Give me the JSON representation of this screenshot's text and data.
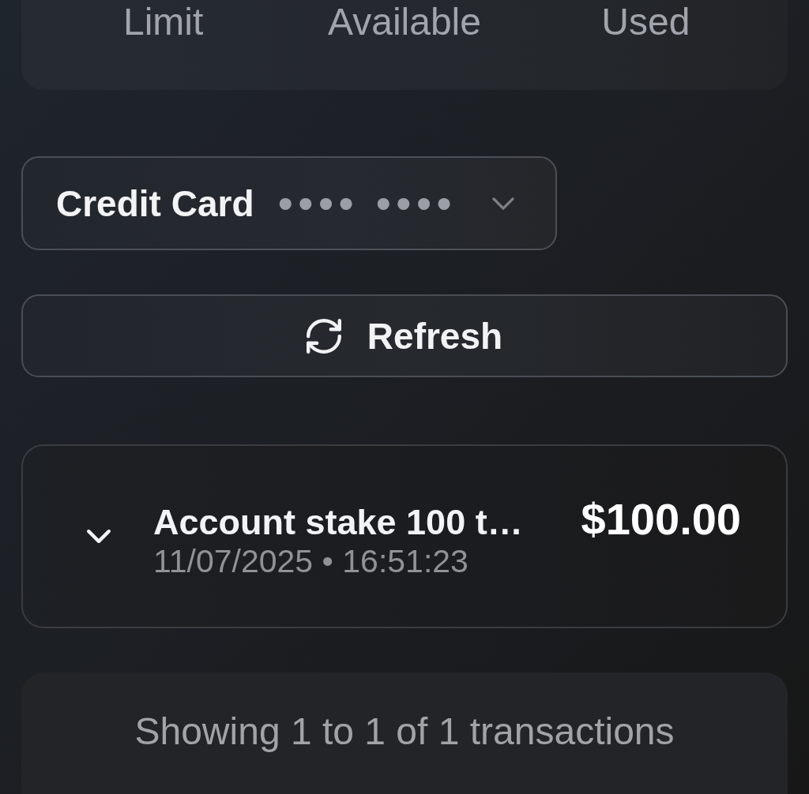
{
  "summary_labels": [
    "Limit",
    "Available",
    "Used"
  ],
  "card_selector": {
    "label": "Credit Card",
    "masked_number": "•••• ••••"
  },
  "refresh_button": {
    "label": "Refresh"
  },
  "transactions": [
    {
      "title": "Account stake 100 t…",
      "datetime": "11/07/2025 • 16:51:23",
      "amount": "$100.00",
      "expanded": false
    }
  ],
  "pagination": {
    "summary": "Showing 1 to 1 of 1 transactions"
  }
}
